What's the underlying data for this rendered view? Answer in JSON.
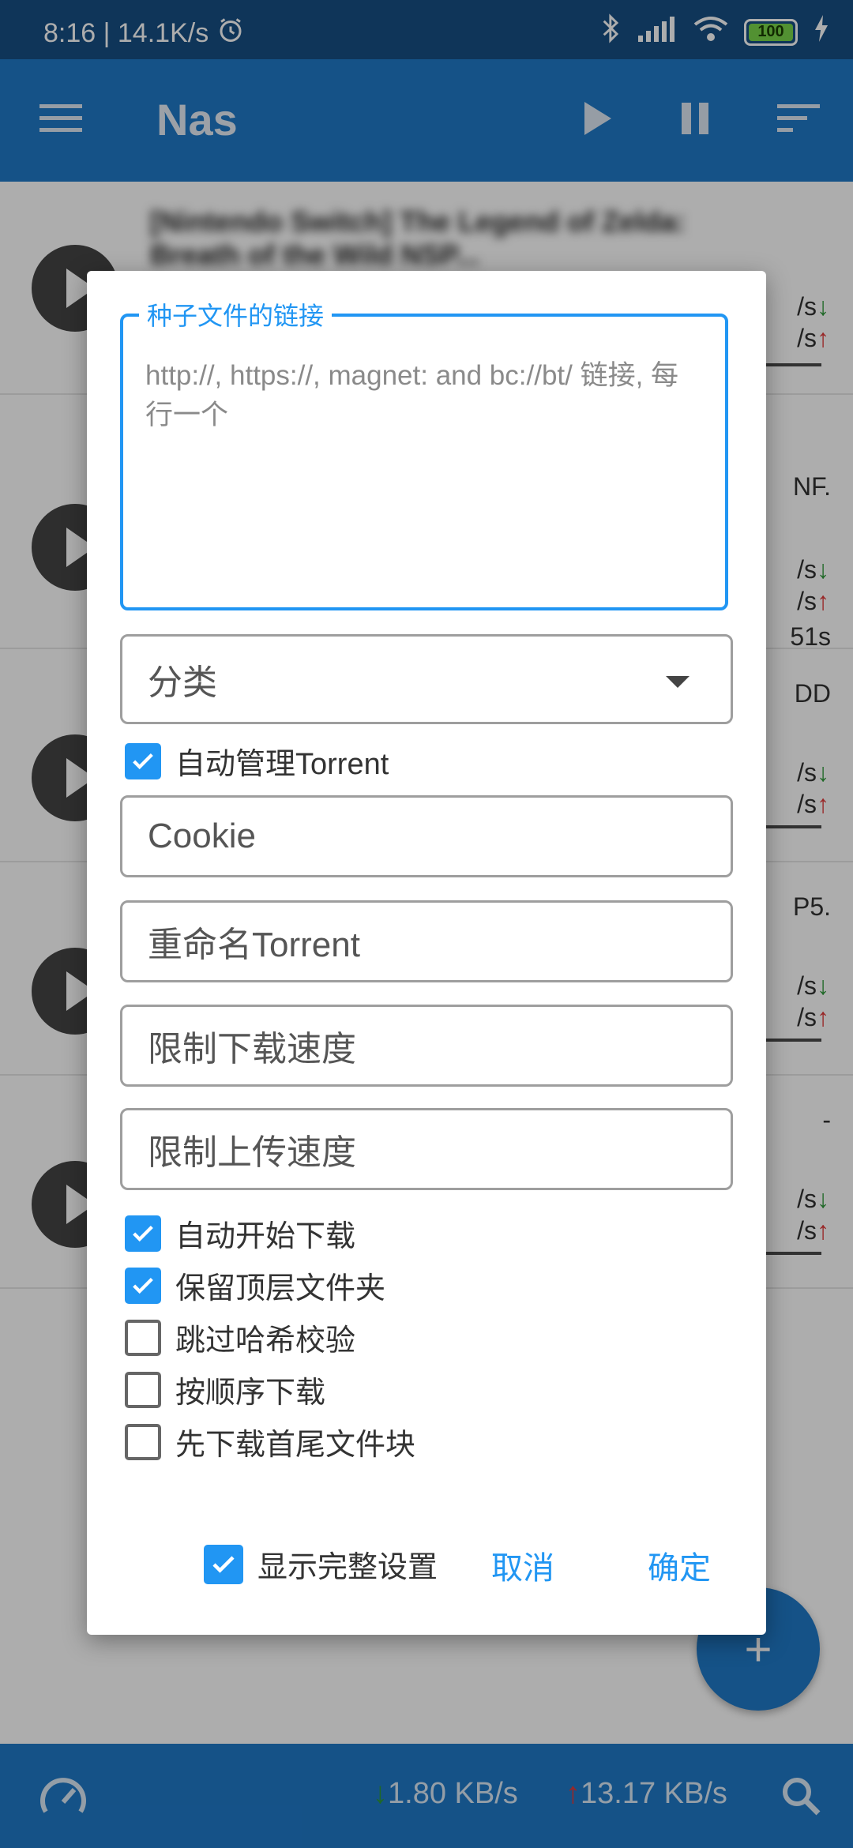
{
  "status_bar": {
    "time_speed": "8:16 | 14.1K/s",
    "battery": "100"
  },
  "toolbar": {
    "title": "Nas"
  },
  "background_rows": [
    {
      "title": "[Nintendo Switch] The Legend of Zelda: Breath of the Wild NSP...",
      "tail": "",
      "dl": "/s",
      "ul": "/s"
    },
    {
      "title": "",
      "tail": "NF.",
      "dl": "/s",
      "ul": "/s",
      "eta": "51s"
    },
    {
      "title": "",
      "tail": "DD",
      "dl": "/s",
      "ul": "/s"
    },
    {
      "title": "",
      "tail": "P5.",
      "dl": "/s",
      "ul": "/s"
    },
    {
      "title": "",
      "tail": "-",
      "dl": "/s",
      "ul": "/s"
    }
  ],
  "dialog": {
    "link_label": "种子文件的链接",
    "link_placeholder": "http://, https://, magnet: and bc://bt/ 链接, 每行一个",
    "category_label": "分类",
    "auto_manage_label": "自动管理Torrent",
    "auto_manage_checked": true,
    "cookie_placeholder": "Cookie",
    "rename_placeholder": "重命名Torrent",
    "dl_limit_placeholder": "限制下载速度",
    "ul_limit_placeholder": "限制上传速度",
    "options": [
      {
        "label": "自动开始下载",
        "checked": true
      },
      {
        "label": "保留顶层文件夹",
        "checked": true
      },
      {
        "label": "跳过哈希校验",
        "checked": false
      },
      {
        "label": "按顺序下载",
        "checked": false
      },
      {
        "label": "先下载首尾文件块",
        "checked": false
      }
    ],
    "show_full_label": "显示完整设置",
    "show_full_checked": true,
    "cancel_label": "取消",
    "ok_label": "确定"
  },
  "bottom_bar": {
    "download_speed": "1.80 KB/s",
    "upload_speed": "13.17 KB/s"
  },
  "fab": {
    "label": "+"
  },
  "colors": {
    "primary": "#1f79c8",
    "accent": "#2196f3",
    "status_bar": "#174f84",
    "down_arrow": "#2e9a3a",
    "up_arrow": "#e23a3a"
  }
}
